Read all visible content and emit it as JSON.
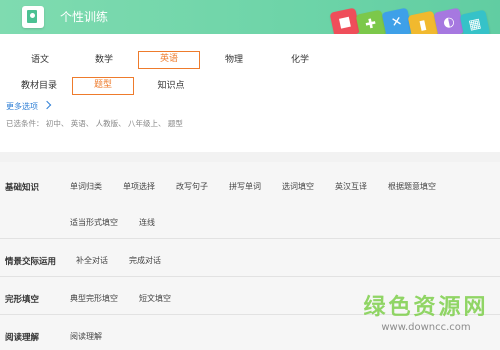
{
  "header": {
    "title": "个性训练",
    "deco_tiles": [
      {
        "icon": "book-icon",
        "glyph": "■",
        "color": "#ef4e5a"
      },
      {
        "icon": "puzzle-icon",
        "glyph": "✚",
        "color": "#7cc84a"
      },
      {
        "icon": "excel-icon",
        "glyph": "✕",
        "color": "#3ea0e8"
      },
      {
        "icon": "bars-icon",
        "glyph": "▮",
        "color": "#f1b92e"
      },
      {
        "icon": "ppt-icon",
        "glyph": "◐",
        "color": "#a678e0"
      },
      {
        "icon": "grid-icon",
        "glyph": "▦",
        "color": "#36c2c8"
      }
    ]
  },
  "subjects": {
    "items": [
      "语文",
      "数学",
      "英语",
      "物理",
      "化学"
    ],
    "selected": "英语"
  },
  "resource_types": {
    "items": [
      "教材目录",
      "题型",
      "知识点"
    ],
    "selected": "题型"
  },
  "more_options": "更多选项",
  "selected_conditions": "已选条件：  初中、  英语、  人教版、  八年级上、  题型",
  "sections": [
    {
      "title": "基础知识",
      "rows": [
        [
          "单词归类",
          "单项选择",
          "改写句子",
          "拼写单词",
          "选词填空",
          "英汉互译",
          "根据题意填空"
        ],
        [
          "适当形式填空",
          "连线"
        ]
      ]
    },
    {
      "title": "情景交际运用",
      "rows": [
        [
          "补全对话",
          "完成对话"
        ]
      ]
    },
    {
      "title": "完形填空",
      "rows": [
        [
          "典型完形填空",
          "短文填空"
        ]
      ]
    },
    {
      "title": "阅读理解",
      "rows": [
        [
          "阅读理解"
        ]
      ]
    }
  ],
  "watermark": {
    "cn": "绿色资源网",
    "en": "www.downcc.com"
  },
  "colors": {
    "header_green": "#6dd4a8",
    "accent_orange": "#ee7b2c",
    "link_blue": "#2f7fd6"
  }
}
